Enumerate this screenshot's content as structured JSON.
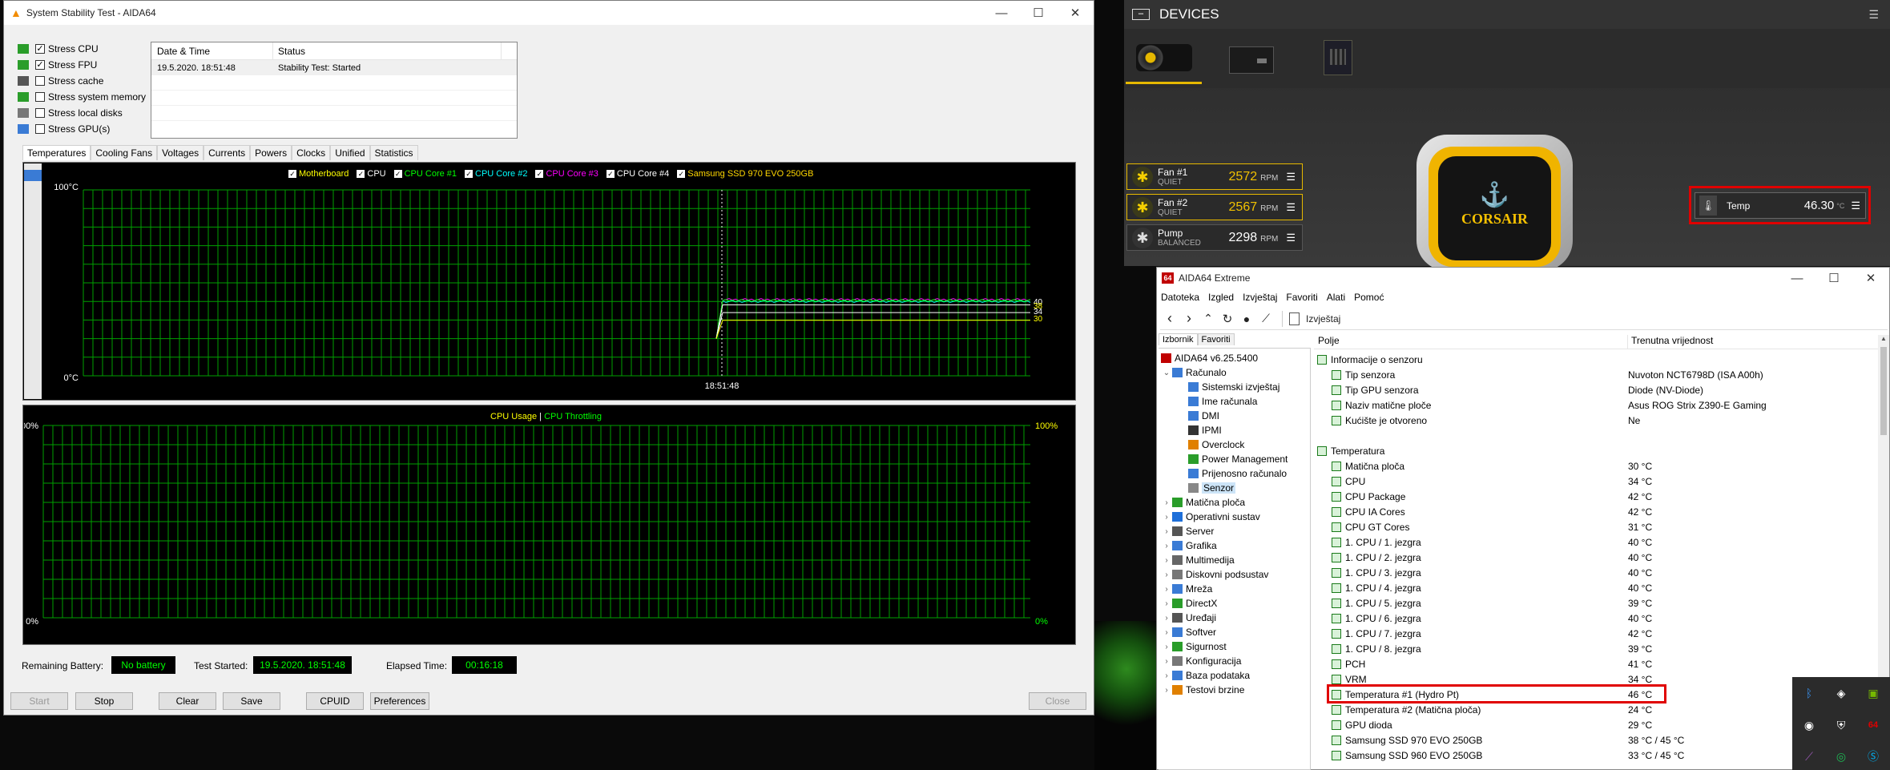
{
  "stability": {
    "title": "System Stability Test - AIDA64",
    "stress": [
      {
        "label": "Stress CPU",
        "checked": "✓"
      },
      {
        "label": "Stress FPU",
        "checked": "✓"
      },
      {
        "label": "Stress cache",
        "checked": ""
      },
      {
        "label": "Stress system memory",
        "checked": ""
      },
      {
        "label": "Stress local disks",
        "checked": ""
      },
      {
        "label": "Stress GPU(s)",
        "checked": ""
      }
    ],
    "log_headers": [
      "Date & Time",
      "Status"
    ],
    "log_rows": [
      [
        "19.5.2020. 18:51:48",
        "Stability Test: Started"
      ]
    ],
    "tabs": [
      "Temperatures",
      "Cooling Fans",
      "Voltages",
      "Currents",
      "Powers",
      "Clocks",
      "Unified",
      "Statistics"
    ],
    "temp_legend": [
      {
        "label": "Motherboard",
        "color": "#ffff00"
      },
      {
        "label": "CPU",
        "color": "#ffffff"
      },
      {
        "label": "CPU Core #1",
        "color": "#00ff00"
      },
      {
        "label": "CPU Core #2",
        "color": "#00ffff"
      },
      {
        "label": "CPU Core #3",
        "color": "#ff00ff"
      },
      {
        "label": "CPU Core #4",
        "color": "#ffffff"
      },
      {
        "label": "Samsung SSD 970 EVO 250GB",
        "color": "#ffd700"
      }
    ],
    "temp_ymax": "100°C",
    "temp_ymin": "0°C",
    "temp_xlabel": "18:51:48",
    "temp_right": [
      "40",
      "38",
      "34",
      "30"
    ],
    "usage_title_a": "CPU Usage",
    "usage_sep": "|",
    "usage_title_b": "CPU Throttling",
    "usage_ymax": "100%",
    "usage_ymin": "0%",
    "battery_label": "Remaining Battery:",
    "battery_value": "No battery",
    "started_label": "Test Started:",
    "started_value": "19.5.2020. 18:51:48",
    "elapsed_label": "Elapsed Time:",
    "elapsed_value": "00:16:18",
    "buttons": {
      "start": "Start",
      "stop": "Stop",
      "clear": "Clear",
      "save": "Save",
      "cpuid": "CPUID",
      "prefs": "Preferences",
      "close": "Close"
    }
  },
  "icue": {
    "devices": "DEVICES",
    "fans": [
      {
        "name": "Fan #1",
        "mode": "QUIET",
        "value": "2572",
        "unit": "RPM"
      },
      {
        "name": "Fan #2",
        "mode": "QUIET",
        "value": "2567",
        "unit": "RPM"
      },
      {
        "name": "Pump",
        "mode": "BALANCED",
        "value": "2298",
        "unit": "RPM"
      }
    ],
    "brand": "CORSAIR",
    "temp_label": "Temp",
    "temp_value": "46.30",
    "temp_unit": "°C",
    "accent": "#e6b800",
    "highlight": "#e00000"
  },
  "aida": {
    "title": "AIDA64 Extreme",
    "menu": [
      "Datoteka",
      "Izgled",
      "Izvještaj",
      "Favoriti",
      "Alati",
      "Pomoć"
    ],
    "report_label": "Izvještaj",
    "left_tabs": [
      "Izbornik",
      "Favoriti"
    ],
    "col_field": "Polje",
    "col_value": "Trenutna vrijednost",
    "tree": [
      {
        "label": "AIDA64 v6.25.5400",
        "lvl": 0,
        "icon": "#c00000"
      },
      {
        "label": "Računalo",
        "lvl": 1,
        "icon": "#3a7bd5",
        "exp": "⌄"
      },
      {
        "label": "Sistemski izvještaj",
        "lvl": 2,
        "icon": "#3a7bd5"
      },
      {
        "label": "Ime računala",
        "lvl": 2,
        "icon": "#3a7bd5"
      },
      {
        "label": "DMI",
        "lvl": 2,
        "icon": "#3a7bd5"
      },
      {
        "label": "IPMI",
        "lvl": 2,
        "icon": "#333"
      },
      {
        "label": "Overclock",
        "lvl": 2,
        "icon": "#e08000"
      },
      {
        "label": "Power Management",
        "lvl": 2,
        "icon": "#2a9d2a"
      },
      {
        "label": "Prijenosno računalo",
        "lvl": 2,
        "icon": "#3a7bd5"
      },
      {
        "label": "Senzor",
        "lvl": 2,
        "icon": "#888",
        "sel": true
      },
      {
        "label": "Matična ploča",
        "lvl": 1,
        "icon": "#2a9d2a",
        "exp": "›"
      },
      {
        "label": "Operativni sustav",
        "lvl": 1,
        "icon": "#1e6fd9",
        "exp": "›"
      },
      {
        "label": "Server",
        "lvl": 1,
        "icon": "#555",
        "exp": "›"
      },
      {
        "label": "Grafika",
        "lvl": 1,
        "icon": "#3a7bd5",
        "exp": "›"
      },
      {
        "label": "Multimedija",
        "lvl": 1,
        "icon": "#666",
        "exp": "›"
      },
      {
        "label": "Diskovni podsustav",
        "lvl": 1,
        "icon": "#777",
        "exp": "›"
      },
      {
        "label": "Mreža",
        "lvl": 1,
        "icon": "#3a7bd5",
        "exp": "›"
      },
      {
        "label": "DirectX",
        "lvl": 1,
        "icon": "#2a9d2a",
        "exp": "›"
      },
      {
        "label": "Uređaji",
        "lvl": 1,
        "icon": "#555",
        "exp": "›"
      },
      {
        "label": "Softver",
        "lvl": 1,
        "icon": "#3a7bd5",
        "exp": "›"
      },
      {
        "label": "Sigurnost",
        "lvl": 1,
        "icon": "#2a9d2a",
        "exp": "›"
      },
      {
        "label": "Konfiguracija",
        "lvl": 1,
        "icon": "#777",
        "exp": "›"
      },
      {
        "label": "Baza podataka",
        "lvl": 1,
        "icon": "#3a7bd5",
        "exp": "›"
      },
      {
        "label": "Testovi brzine",
        "lvl": 1,
        "icon": "#e08000",
        "exp": "›"
      }
    ],
    "rows": [
      {
        "name": "Informacije o senzoru",
        "value": "",
        "section": true
      },
      {
        "name": "Tip senzora",
        "value": "Nuvoton NCT6798D  (ISA A00h)"
      },
      {
        "name": "Tip GPU senzora",
        "value": "Diode  (NV-Diode)"
      },
      {
        "name": "Naziv matične ploče",
        "value": "Asus ROG Strix Z390-E Gaming"
      },
      {
        "name": "Kućište je otvoreno",
        "value": "Ne"
      },
      {
        "name": "",
        "value": ""
      },
      {
        "name": "Temperatura",
        "value": "",
        "section": true
      },
      {
        "name": "Matična ploča",
        "value": "30 °C"
      },
      {
        "name": "CPU",
        "value": "34 °C"
      },
      {
        "name": "CPU Package",
        "value": "42 °C"
      },
      {
        "name": "CPU IA Cores",
        "value": "42 °C"
      },
      {
        "name": "CPU GT Cores",
        "value": "31 °C"
      },
      {
        "name": "1. CPU / 1. jezgra",
        "value": "40 °C"
      },
      {
        "name": "1. CPU / 2. jezgra",
        "value": "40 °C"
      },
      {
        "name": "1. CPU / 3. jezgra",
        "value": "40 °C"
      },
      {
        "name": "1. CPU / 4. jezgra",
        "value": "40 °C"
      },
      {
        "name": "1. CPU / 5. jezgra",
        "value": "39 °C"
      },
      {
        "name": "1. CPU / 6. jezgra",
        "value": "40 °C"
      },
      {
        "name": "1. CPU / 7. jezgra",
        "value": "42 °C"
      },
      {
        "name": "1. CPU / 8. jezgra",
        "value": "39 °C"
      },
      {
        "name": "PCH",
        "value": "41 °C"
      },
      {
        "name": "VRM",
        "value": "34 °C"
      },
      {
        "name": "Temperatura #1 (Hydro Pt)",
        "value": "46 °C",
        "hl": true
      },
      {
        "name": "Temperatura #2 (Matična ploča)",
        "value": "24 °C"
      },
      {
        "name": "GPU dioda",
        "value": "29 °C"
      },
      {
        "name": "Samsung SSD 970 EVO 250GB",
        "value": "38 °C / 45 °C"
      },
      {
        "name": "Samsung SSD 960 EVO 250GB",
        "value": "33 °C / 45 °C"
      }
    ]
  }
}
